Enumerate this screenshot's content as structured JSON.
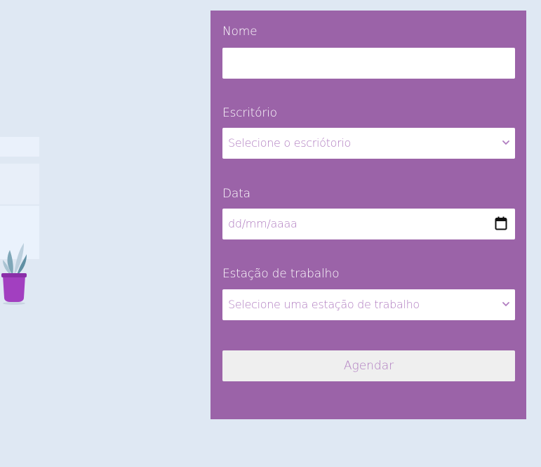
{
  "form": {
    "name_label": "Nome",
    "name_value": "",
    "office_label": "Escritório",
    "office_placeholder": "Selecione o escriótorio",
    "date_label": "Data",
    "date_placeholder": "dd/mm/aaaa",
    "workstation_label": "Estação de trabalho",
    "workstation_placeholder": "Selecione uma estação de trabalho",
    "submit_label": "Agendar"
  },
  "icons": {
    "office_select": "chevron-down-icon",
    "date_picker": "calendar-icon",
    "workstation_select": "chevron-down-icon"
  },
  "colors": {
    "background": "#dfe8f3",
    "panel": "#9b63a8",
    "placeholder_text": "#b07cc0",
    "button_bg": "#efefef",
    "plant_pot": "#a23fc0"
  }
}
